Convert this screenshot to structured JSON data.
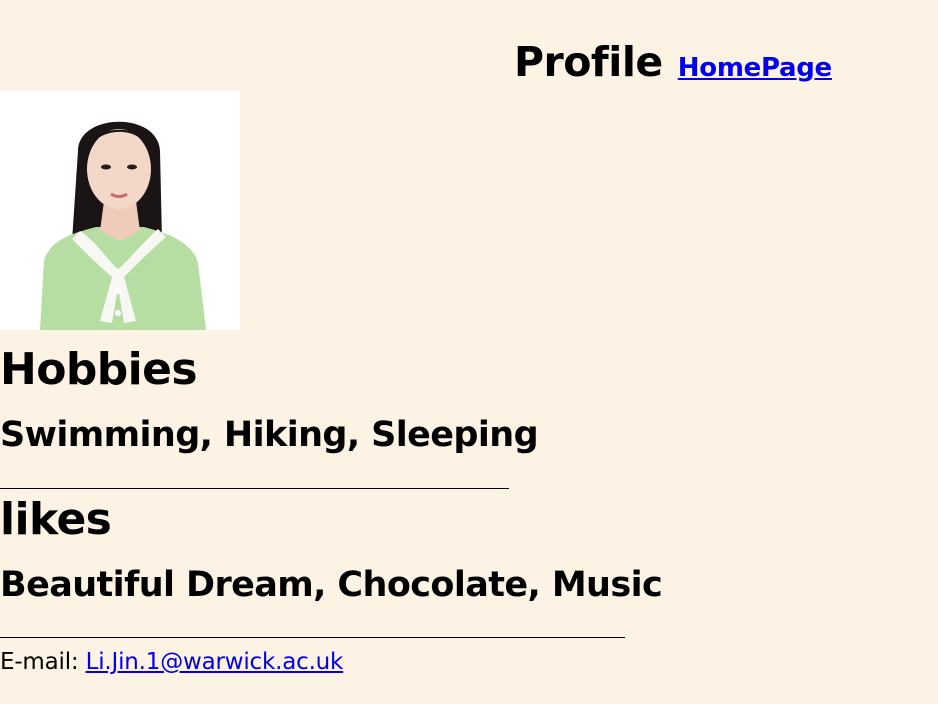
{
  "header": {
    "title": "Profile",
    "home_link": "HomePage"
  },
  "photo": {
    "description_icon": "profile-photo",
    "colors": {
      "background": "#ffffff",
      "hair": "#1a1414",
      "skin": "#f3d7c8",
      "sweater": "#b6dda2",
      "scarf": "#f7f7f4"
    }
  },
  "hobbies": {
    "heading": "Hobbies",
    "value": "Swimming, Hiking, Sleeping"
  },
  "likes": {
    "heading": "likes",
    "value": "Beautiful Dream, Chocolate, Music"
  },
  "contact": {
    "label": "E-mail: ",
    "email": "Li.Jin.1@warwick.ac.uk"
  },
  "colors": {
    "page_background": "#fdf3e4",
    "link": "#0000ee",
    "text": "#000000"
  }
}
